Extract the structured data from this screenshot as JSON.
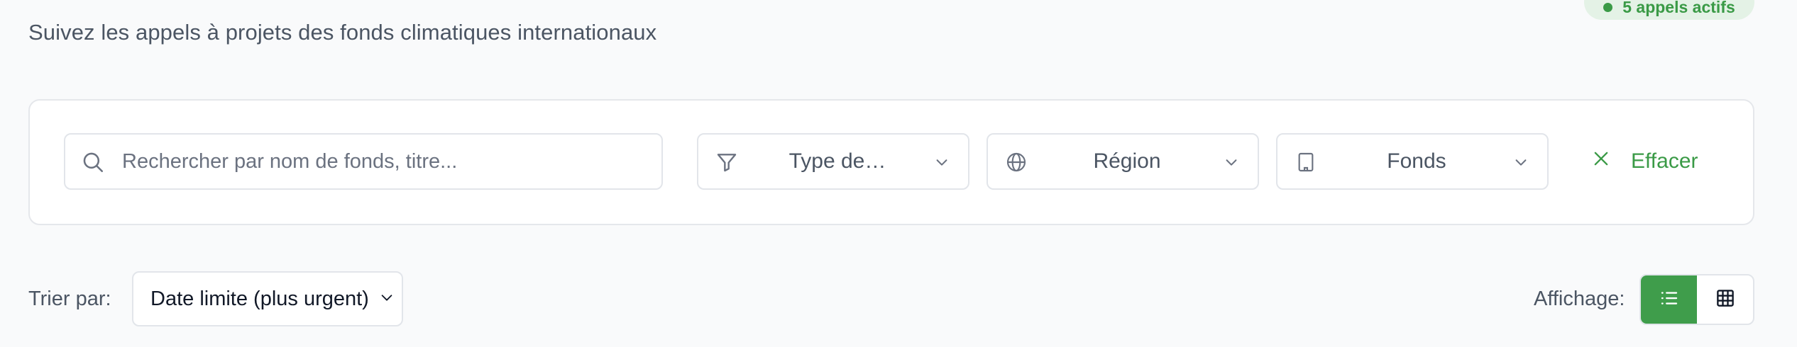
{
  "header": {
    "subtitle": "Suivez les appels à projets des fonds climatiques internationaux",
    "active_badge": "5 appels actifs"
  },
  "filters": {
    "search_placeholder": "Rechercher par nom de fonds, titre...",
    "type_label": "Type de…",
    "region_label": "Région",
    "fund_label": "Fonds",
    "clear_label": "Effacer"
  },
  "sort": {
    "label": "Trier par:",
    "selected": "Date limite (plus urgent)"
  },
  "view": {
    "label": "Affichage:",
    "active": "list"
  },
  "colors": {
    "accent": "#3f9d4b",
    "badge_bg": "#e4f2e6",
    "muted_text": "#4b5563"
  },
  "icons": [
    "search-icon",
    "filter-icon",
    "globe-icon",
    "building-icon",
    "chevron-down-icon",
    "close-icon",
    "list-icon",
    "grid-icon"
  ]
}
